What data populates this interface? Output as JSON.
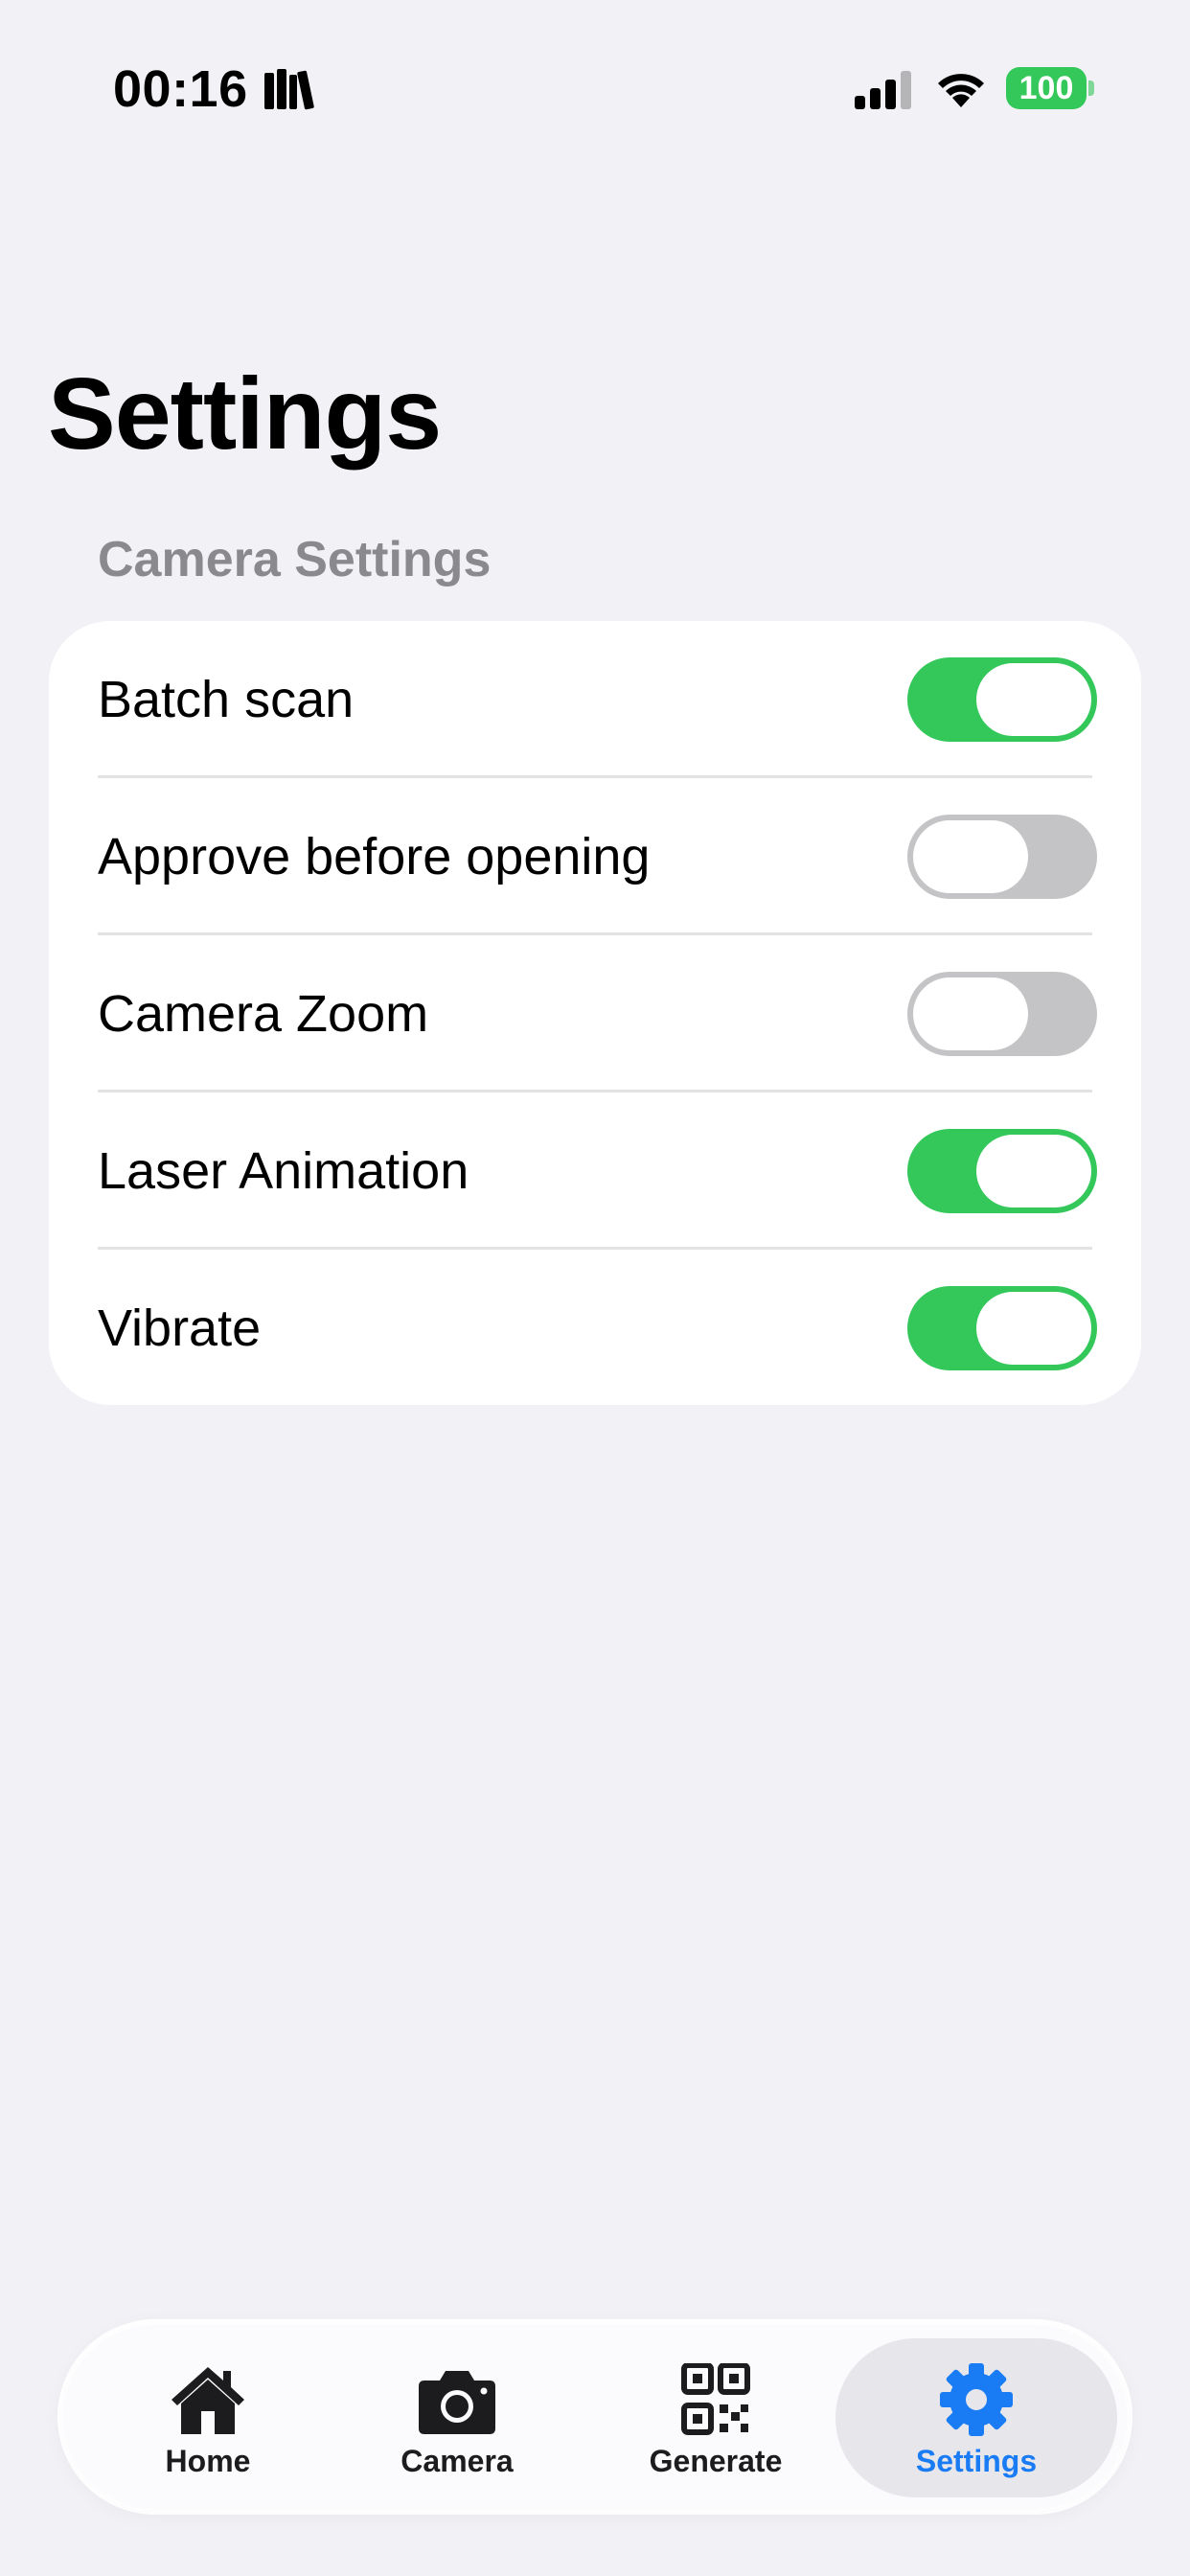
{
  "status_bar": {
    "time": "00:16",
    "battery": "100",
    "colors": {
      "battery": "#34C759"
    }
  },
  "header": {
    "title": "Settings"
  },
  "camera_settings": {
    "section_title": "Camera Settings",
    "items": [
      {
        "label": "Batch scan",
        "enabled": true
      },
      {
        "label": "Approve before opening",
        "enabled": false
      },
      {
        "label": "Camera Zoom",
        "enabled": false
      },
      {
        "label": "Laser Animation",
        "enabled": true
      },
      {
        "label": "Vibrate",
        "enabled": true
      }
    ]
  },
  "tab_bar": {
    "tabs": [
      {
        "label": "Home",
        "icon": "house-icon",
        "active": false
      },
      {
        "label": "Camera",
        "icon": "camera-icon",
        "active": false
      },
      {
        "label": "Generate",
        "icon": "qr-code-icon",
        "active": false
      },
      {
        "label": "Settings",
        "icon": "gear-icon",
        "active": true
      }
    ]
  },
  "colors": {
    "background": "#F2F1F6",
    "toggle_on": "#34C759",
    "toggle_off": "#C4C4C6",
    "accent": "#1A7CF4",
    "section_header": "#8A8A8E"
  }
}
